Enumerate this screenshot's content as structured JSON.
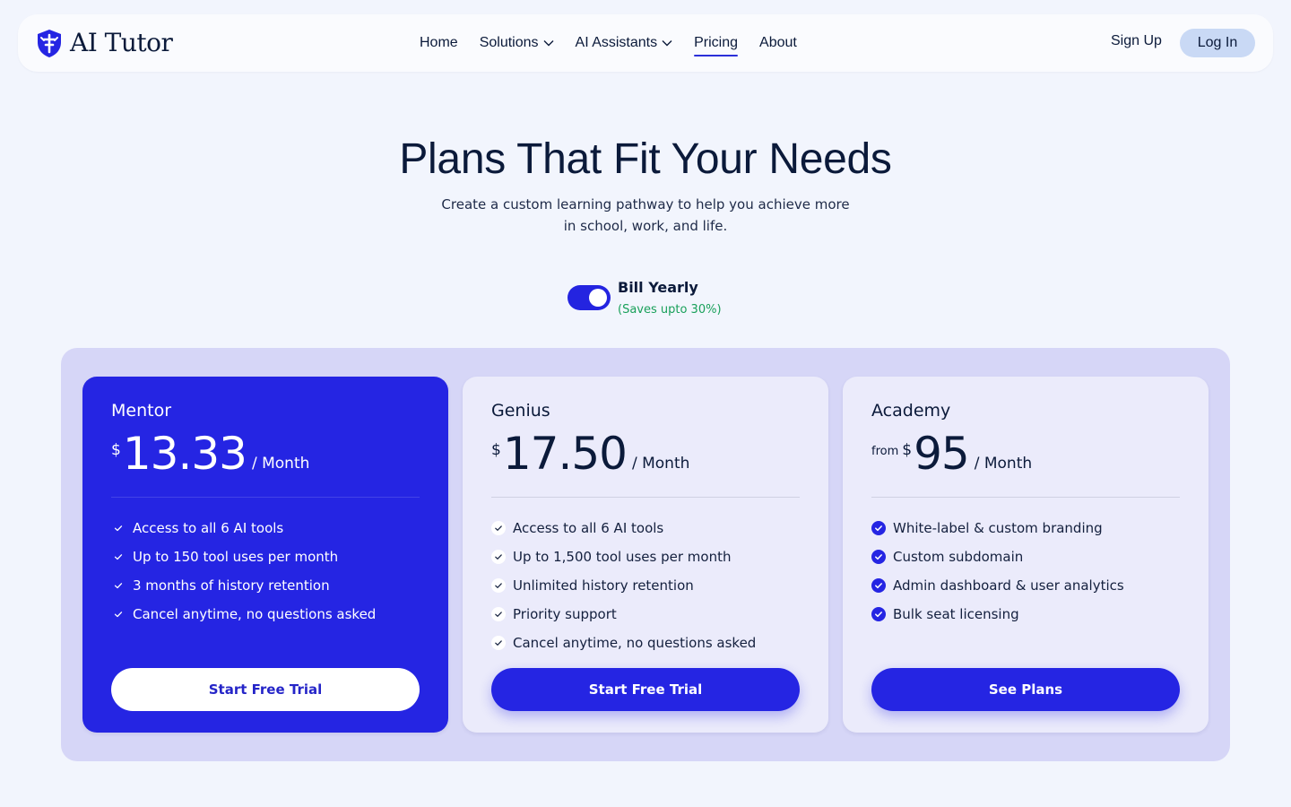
{
  "brand": {
    "name": "AI Tutor",
    "logo_icon": "shield-logo-icon",
    "accent": "#2525e3"
  },
  "nav": {
    "links": [
      {
        "label": "Home"
      },
      {
        "label": "Solutions",
        "dropdown": true
      },
      {
        "label": "AI Assistants",
        "dropdown": true
      },
      {
        "label": "Pricing",
        "active": true
      },
      {
        "label": "About"
      }
    ],
    "signup_label": "Sign Up",
    "login_label": "Log In"
  },
  "hero": {
    "title": "Plans That Fit Your Needs",
    "subtitle_line1": "Create a custom learning pathway to help you achieve more",
    "subtitle_line2": "in school, work, and life."
  },
  "billing": {
    "toggle_on": true,
    "label": "Bill Yearly",
    "savings": "(Saves upto 30%)",
    "savings_color": "#19a05a"
  },
  "plans": [
    {
      "name": "Mentor",
      "currency": "$",
      "amount": "13.33",
      "period": "/ Month",
      "features": [
        "Access to all 6 AI tools",
        "Up to 150 tool uses per month",
        "3 months of history retention",
        "Cancel anytime, no questions asked"
      ],
      "cta": "Start Free Trial",
      "highlighted": true
    },
    {
      "name": "Genius",
      "currency": "$",
      "amount": "17.50",
      "period": "/ Month",
      "features": [
        "Access to all 6 AI tools",
        "Up to 1,500 tool uses per month",
        "Unlimited history retention",
        "Priority support",
        "Cancel anytime, no questions asked"
      ],
      "cta": "Start Free Trial"
    },
    {
      "name": "Academy",
      "prefix": "from",
      "currency": "$",
      "amount": "95",
      "period": "/ Month",
      "features": [
        "White-label & custom branding",
        "Custom subdomain",
        "Admin dashboard & user analytics",
        "Bulk seat licensing"
      ],
      "cta": "See Plans"
    }
  ]
}
